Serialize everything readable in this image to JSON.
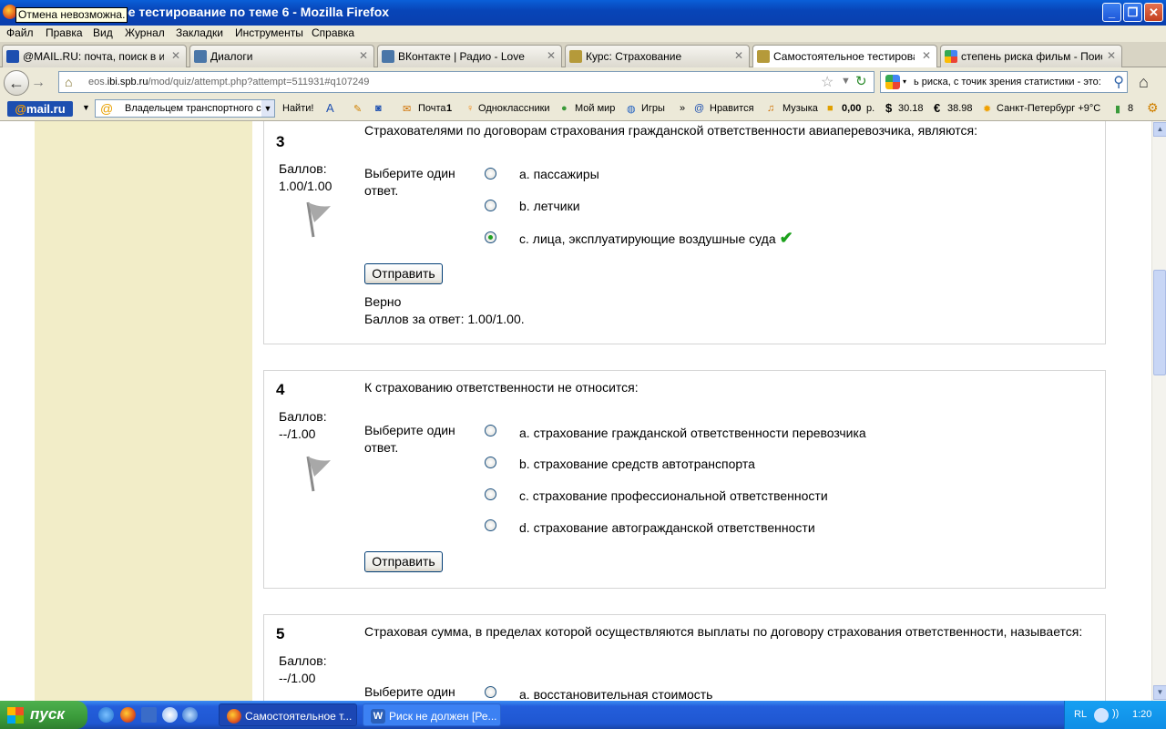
{
  "window": {
    "title": "Самостоятельное тестирование по теме 6 - Mozilla Firefox",
    "tooltip": "Отмена невозможна."
  },
  "menu": [
    "Файл",
    "Правка",
    "Вид",
    "Журнал",
    "Закладки",
    "Инструменты",
    "Справка"
  ],
  "tabs": [
    {
      "label": "@MAIL.RU: почта, поиск в ин...",
      "icon": "mailru-icon",
      "color": "#1d4fb0"
    },
    {
      "label": "Диалоги",
      "icon": "vk-dialog-icon",
      "color": "#4a76a8"
    },
    {
      "label": "ВКонтакте | Радио - Love",
      "icon": "vk-icon",
      "color": "#4a76a8"
    },
    {
      "label": "Курс: Страхование",
      "icon": "moodle-icon",
      "color": "#b59a3a"
    },
    {
      "label": "Самостоятельное тестирован...",
      "icon": "moodle-icon",
      "color": "#b59a3a"
    },
    {
      "label": "степень риска фильм - Поиск ...",
      "icon": "google-icon",
      "color": "#4285f4"
    }
  ],
  "nav": {
    "url_prefix": "eos.",
    "url_domain": "ibi.spb.ru",
    "url_path": "/mod/quiz/attempt.php?attempt=511931#q107249",
    "search_value": "ь риска, с точик зрения статистики - это:"
  },
  "mailbar": {
    "logo_at": "@",
    "logo_text": "mail.ru",
    "search_value": "Владельцем транспортного с",
    "find": "Найти!",
    "mail": "Почта",
    "mail_count": "1",
    "ok": "Одноклассники",
    "moi_mir": "Мой мир",
    "games": "Игры",
    "more": "»",
    "likes": "Нравится",
    "music": "Музыка",
    "balance": "0,00",
    "balance_unit": "р.",
    "usd": "30.18",
    "eur": "38.98",
    "weather": "Санкт-Петербург +9°C",
    "traffic": "8"
  },
  "questions": [
    {
      "number": "3",
      "score_label": "Баллов:",
      "score": "1.00/1.00",
      "text": "Страхователями по договорам страхования гражданской ответственности авиаперевозчика, являются:",
      "prompt": "Выберите один ответ.",
      "options": [
        "a. пассажиры",
        "b. летчики",
        "c. лица, эксплуатирующие воздушные суда"
      ],
      "selected": 2,
      "check": "✔",
      "submit": "Отправить",
      "feedback": "Верно",
      "feedback_score": "Баллов за ответ: 1.00/1.00."
    },
    {
      "number": "4",
      "score_label": "Баллов:",
      "score": "--/1.00",
      "text": "К страхованию ответственности не относится:",
      "prompt": "Выберите один ответ.",
      "options": [
        "a. страхование гражданской ответственности перевозчика",
        "b. страхование средств автотранспорта",
        "c. страхование профессиональной ответственности",
        "d. страхование автогражданской ответственности"
      ],
      "submit": "Отправить"
    },
    {
      "number": "5",
      "score_label": "Баллов:",
      "score": "--/1.00",
      "text": "Страховая сумма, в пределах которой осуществляются выплаты по договору страхования ответственности, называется:",
      "prompt": "Выберите один",
      "options": [
        "a. восстановительная стоимость"
      ]
    }
  ],
  "taskbar": {
    "start": "пуск",
    "tasks": [
      "Самостоятельное т...",
      "Риск не должен [Ре..."
    ],
    "lang": "RL",
    "clock": "1:20"
  }
}
